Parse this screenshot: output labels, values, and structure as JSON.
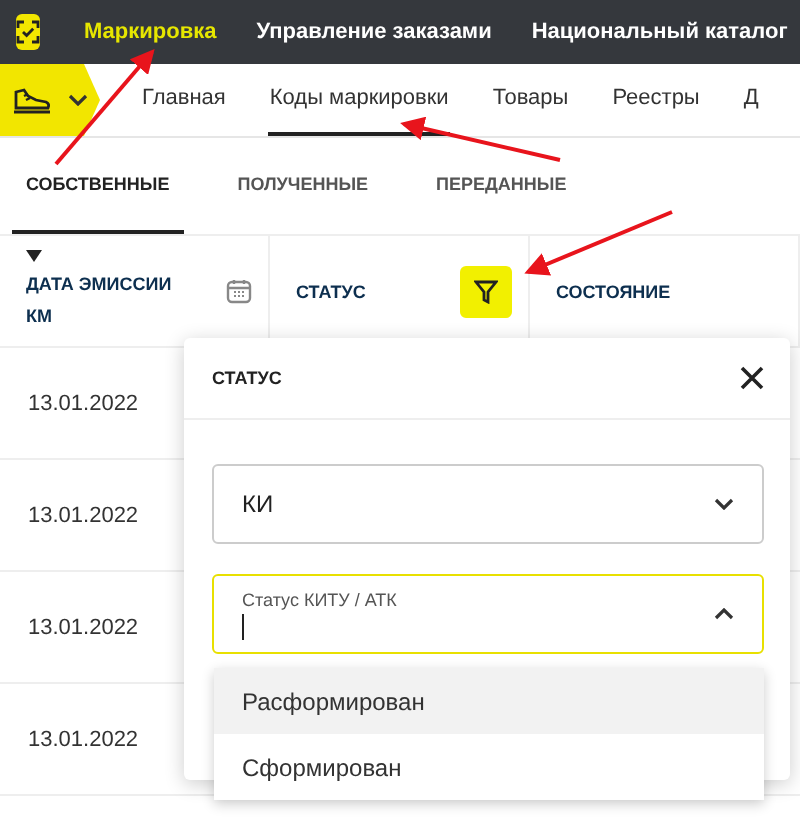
{
  "top_nav": {
    "items": [
      {
        "label": "Маркировка",
        "selected": true
      },
      {
        "label": "Управление заказами",
        "selected": false
      },
      {
        "label": "Национальный каталог",
        "selected": false
      }
    ]
  },
  "main_nav": {
    "items": [
      {
        "label": "Главная",
        "selected": false
      },
      {
        "label": "Коды маркировки",
        "selected": true
      },
      {
        "label": "Товары",
        "selected": false
      },
      {
        "label": "Реестры",
        "selected": false
      },
      {
        "label": "Д",
        "selected": false
      }
    ]
  },
  "sub_tabs": [
    {
      "label": "СОБСТВЕННЫЕ",
      "selected": true
    },
    {
      "label": "ПОЛУЧЕННЫЕ",
      "selected": false
    },
    {
      "label": "ПЕРЕДАННЫЕ",
      "selected": false
    }
  ],
  "table": {
    "columns": [
      {
        "label": "ДАТА ЭМИССИИ КМ",
        "kind": "date",
        "sorted": true
      },
      {
        "label": "СТАТУС",
        "kind": "filter",
        "filter_active": true
      },
      {
        "label": "СОСТОЯНИЕ",
        "kind": "plain"
      }
    ],
    "rows": [
      {
        "date": "13.01.2022"
      },
      {
        "date": "13.01.2022"
      },
      {
        "date": "13.01.2022"
      },
      {
        "date": "13.01.2022"
      }
    ]
  },
  "filter_popup": {
    "title": "СТАТУС",
    "fields": [
      {
        "kind": "select",
        "value": "КИ",
        "focused": false,
        "expanded": false
      },
      {
        "kind": "select",
        "label": "Статус КИТУ / АТК",
        "focused": true,
        "expanded": true
      }
    ],
    "options": [
      {
        "label": "Расформирован",
        "highlighted": true
      },
      {
        "label": "Сформирован",
        "highlighted": false
      }
    ]
  }
}
